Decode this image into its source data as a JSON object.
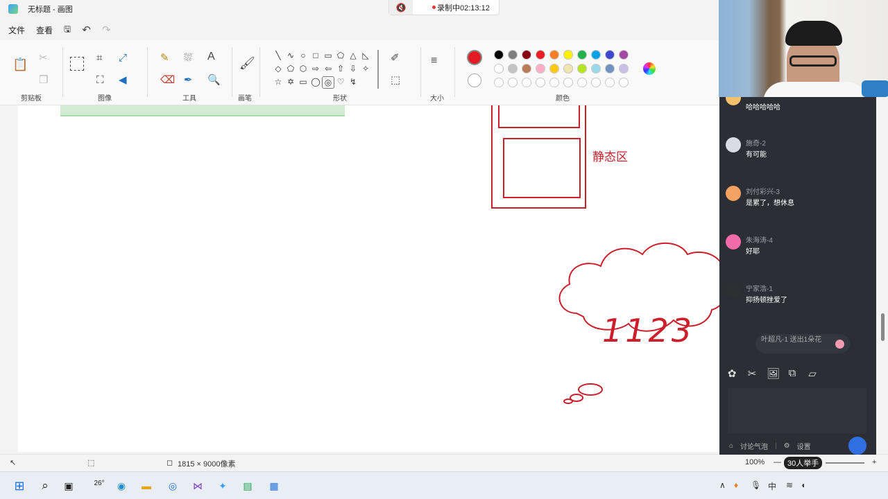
{
  "window": {
    "title": "无标题 - 画图"
  },
  "recording": {
    "label": "录制中02:13:12"
  },
  "menu": {
    "file": "文件",
    "view": "查看"
  },
  "ribbon": {
    "groups": {
      "clipboard": "剪贴板",
      "image": "图像",
      "tools": "工具",
      "brushes": "画笔",
      "shapes": "形状",
      "size": "大小",
      "colors": "颜色"
    },
    "shapes": [
      "╲",
      "∿",
      "○",
      "□",
      "▭",
      "⬠",
      "△",
      "◺",
      "◇",
      "⬠",
      "⬡",
      "⇨",
      "⇦",
      "⇧",
      "⇩",
      "✧",
      "☆",
      "✡",
      "▭",
      "◯",
      "◎",
      "♡",
      "↯"
    ],
    "active_color": "#e31b23",
    "palette": [
      "#000000",
      "#7f7f7f",
      "#880015",
      "#ed1c24",
      "#ff7f27",
      "#fff200",
      "#22b14c",
      "#00a2e8",
      "#3f48cc",
      "#a349a4",
      "#ffffff",
      "#c3c3c3",
      "#b97a57",
      "#ffaec9",
      "#ffc90e",
      "#efe4b0",
      "#b5e61d",
      "#99d9ea",
      "#7092be",
      "#c8bfe7",
      "#ffffff",
      "#ffffff",
      "#ffffff",
      "#ffffff",
      "#ffffff",
      "#ffffff",
      "#ffffff",
      "#ffffff",
      "#ffffff",
      "#ffffff"
    ]
  },
  "canvas": {
    "static_label": "静态区",
    "cloud_text": "1123"
  },
  "status": {
    "dimensions": "1815 × 9000像素",
    "zoom": "100%",
    "raise_hand": "30人举手"
  },
  "chat": {
    "messages": [
      {
        "user": "",
        "text": "哈哈哈哈哈",
        "avatar": "#f3c26b"
      },
      {
        "user": "施奇-2",
        "text": "有可能",
        "avatar": "#d8dde5"
      },
      {
        "user": "刘付彩兴-3",
        "text": "是累了，想休息",
        "avatar": "#f4a261"
      },
      {
        "user": "朱海涛-4",
        "text": "好耶",
        "avatar": "#f06ba8"
      },
      {
        "user": "宁家浩-1",
        "text": "抑扬顿挫爱了",
        "avatar": "#2d2f33"
      }
    ],
    "gift": "叶超凡-1 送出1朵花",
    "footer_bubble": "讨论气泡",
    "footer_settings": "设置"
  },
  "taskbar": {
    "weather": "26°",
    "ime": "中"
  }
}
